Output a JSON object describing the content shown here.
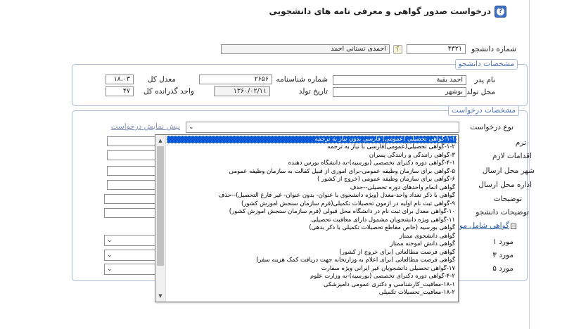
{
  "page": {
    "title": "درخواست صدور گواهی و معرفی نامه های دانشجویی"
  },
  "student": {
    "number_label": "شماره دانشجو",
    "number_value": "۴۳۲۱",
    "name_value": "احمدی تستانی احمد",
    "lookup_icon": "؟"
  },
  "student_info": {
    "legend": "مشخصات دانشجو",
    "father_label": "نام پدر",
    "father_value": "احمد بقیة",
    "id_label": "شماره شناسنامه",
    "id_value": "۲۶۵۶",
    "gpa_label": "معدل کل",
    "gpa_value": "۱۸.۰۳",
    "birthplace_label": "محل تولد",
    "birthplace_value": "بوشهر",
    "birthdate_label": "تاریخ تولد",
    "birthdate_value": "۱۳۶۰/۰۲/۱۱",
    "units_label": "واحد گذرانده کل",
    "units_value": "۴۷"
  },
  "request_info": {
    "legend": "مشخصات درخواست",
    "type_label": "نوع درخواست",
    "preview_link": "پیش نمایش درخواست",
    "term_label": "ترم",
    "actions_label": "اقدامات لازم",
    "city_label": "شهر محل ارسال",
    "office_label": "اداره محل ارسال",
    "notes_label": "توضیحات",
    "student_notes_label": "توضیحات دانشجو",
    "includes_label": "گواهی شامل مو",
    "item1_label": "مورد ۱",
    "item3_label": "مورد ۳",
    "item5_label": "مورد ۵"
  },
  "dropdown": {
    "options": [
      "۱-۱-گواهی تحصیلی (عمومی) فارسی بدون نیاز به ترجمه",
      "۱-۲-گواهی تحصیلی(عمومی)فارسی با نیاز به ترجمه",
      "۳-گواهی رانندگی و رانندگی پسران",
      "۴-۱-گواهی دوره دکترای تخصصی (بورسیه)-به دانشگاه بورس دهنده",
      "۵-گواهی برای سازمان وظیفه عمومی-برای اموری از قبیل کفالت به سازمان وظیفه عمومی",
      "۶-گواهی برای سازمان وظیفه عمومی (خروج از کشور )",
      "گواهی اتمام واحدهای دوره تحصیلی--حذف",
      "گواهی با ذکر تعداد واحد-معدل (ویژه دانشجوی با عنوان- بدون عنوان- غیر فارغ التحصیل)--حذف",
      "۹-گواهی ثبت نام اولیه در آزمون تحصیلات تکمیلی(فرم سازمان سنجش آموزش کشور)",
      "۱۰-گواهی معدل برای ثبت نام در دانشگاه محل قبولی (فرم سازمان سنجش آموزش کشور)",
      "۱۱-گواهی ویژه دانشجویان مشمول دارای معافیت تحصیلی",
      "گواهی بورسیه (خاص مقاطع تحصیلات تکمیلی با ذکر بدهی)",
      "گواهی دانشجوی ممتاز",
      "گواهی دانش آموخته ممتاز",
      "گواهی فرصت مطالعاتی (برای خروج از کشور)",
      "گواهی فرصت مطالعاتی (برای اعلام به وزارتخانه جهت دریافت کمک هزینه سفر)",
      "۱۷-گواهی تحصیلی دانشجویان غیر ایرانی ویژه سفارت",
      "۴-۲-گواهی دوره دکترای تخصصی (بورسیه)-به وزارت علوم",
      "۱۸-۱-معافیت_کارشناسی و دکتری عمومی دامپزشکی",
      "۱۸-۲-معافیت_تحصیلات تکمیلی"
    ],
    "selected_index": 0
  }
}
